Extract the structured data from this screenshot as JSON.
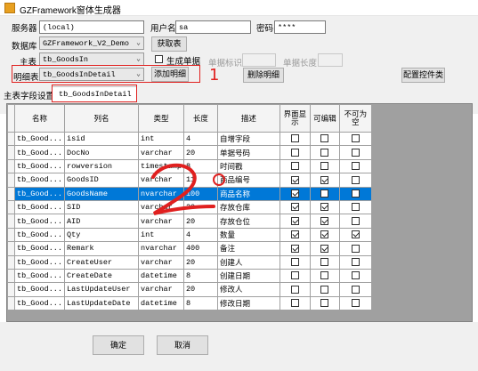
{
  "window": {
    "title": "GZFramework窗体生成器"
  },
  "form": {
    "server_label": "服务器",
    "server_value": "(local)",
    "user_label": "用户名",
    "user_value": "sa",
    "password_label": "密码",
    "password_value": "****",
    "database_label": "数据库",
    "database_value": "GZFramework_V2_Demo",
    "get_tables_button": "获取表",
    "main_table_label": "主表",
    "main_table_value": "tb_GoodsIn",
    "gen_single_label": "生成单据",
    "gen_single_checked": false,
    "single_id_label": "单据标识",
    "single_id_value": "",
    "single_len_label": "单据长度",
    "single_len_value": "",
    "detail_table_label": "明细表",
    "detail_table_value": "tb_GoodsInDetail",
    "add_detail_button": "添加明细",
    "delete_detail_button": "删除明细",
    "config_button": "配置控件类",
    "field_settings_label": "主表字段设置",
    "field_settings_tab": "tb_GoodsInDetail"
  },
  "annotations": {
    "mark1": "1",
    "mark2": "2"
  },
  "grid": {
    "columns": [
      "名称",
      "列名",
      "类型",
      "长度",
      "描述",
      "界面显示",
      "可编辑",
      "不可为空"
    ],
    "rows": [
      {
        "name": "tb_Good...",
        "column": "isid",
        "type": "int",
        "length": "4",
        "desc": "自增字段",
        "show": false,
        "edit": false,
        "notnull": false,
        "selected": false
      },
      {
        "name": "tb_Good...",
        "column": "DocNo",
        "type": "varchar",
        "length": "20",
        "desc": "单据号码",
        "show": false,
        "edit": false,
        "notnull": false,
        "selected": false
      },
      {
        "name": "tb_Good...",
        "column": "rowversion",
        "type": "timestamp",
        "length": "8",
        "desc": "时间戳",
        "show": false,
        "edit": false,
        "notnull": false,
        "selected": false
      },
      {
        "name": "tb_Good...",
        "column": "GoodsID",
        "type": "varchar",
        "length": "11",
        "desc": "商品编号",
        "show": true,
        "edit": true,
        "notnull": false,
        "selected": false
      },
      {
        "name": "tb_Good...",
        "column": "GoodsName",
        "type": "nvarchar",
        "length": "100",
        "desc": "商品名称",
        "show": true,
        "edit": false,
        "notnull": false,
        "selected": true
      },
      {
        "name": "tb_Good...",
        "column": "SID",
        "type": "varchar",
        "length": "20",
        "desc": "存放仓库",
        "show": true,
        "edit": true,
        "notnull": false,
        "selected": false
      },
      {
        "name": "tb_Good...",
        "column": "AID",
        "type": "varchar",
        "length": "20",
        "desc": "存放仓位",
        "show": true,
        "edit": true,
        "notnull": false,
        "selected": false
      },
      {
        "name": "tb_Good...",
        "column": "Qty",
        "type": "int",
        "length": "4",
        "desc": "数量",
        "show": true,
        "edit": true,
        "notnull": true,
        "selected": false
      },
      {
        "name": "tb_Good...",
        "column": "Remark",
        "type": "nvarchar",
        "length": "400",
        "desc": "备注",
        "show": true,
        "edit": true,
        "notnull": false,
        "selected": false
      },
      {
        "name": "tb_Good...",
        "column": "CreateUser",
        "type": "varchar",
        "length": "20",
        "desc": "创建人",
        "show": false,
        "edit": false,
        "notnull": false,
        "selected": false
      },
      {
        "name": "tb_Good...",
        "column": "CreateDate",
        "type": "datetime",
        "length": "8",
        "desc": "创建日期",
        "show": false,
        "edit": false,
        "notnull": false,
        "selected": false
      },
      {
        "name": "tb_Good...",
        "column": "LastUpdateUser",
        "type": "varchar",
        "length": "20",
        "desc": "修改人",
        "show": false,
        "edit": false,
        "notnull": false,
        "selected": false
      },
      {
        "name": "tb_Good...",
        "column": "LastUpdateDate",
        "type": "datetime",
        "length": "8",
        "desc": "修改日期",
        "show": false,
        "edit": false,
        "notnull": false,
        "selected": false
      }
    ]
  },
  "footer": {
    "ok_button": "确定",
    "cancel_button": "取消"
  },
  "colors": {
    "selection": "#0078d7",
    "annotation_red": "#e0201f"
  }
}
